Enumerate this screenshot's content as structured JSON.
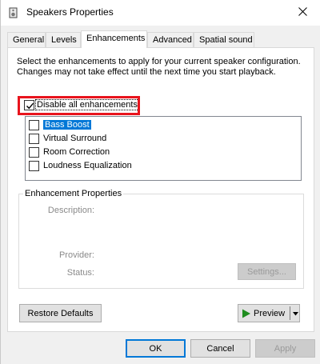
{
  "window": {
    "title": "Speakers Properties"
  },
  "tabs": [
    {
      "label": "General",
      "active": false
    },
    {
      "label": "Levels",
      "active": false
    },
    {
      "label": "Enhancements",
      "active": true
    },
    {
      "label": "Advanced",
      "active": false
    },
    {
      "label": "Spatial sound",
      "active": false
    }
  ],
  "enhancements": {
    "description": "Select the enhancements to apply for your current speaker configuration. Changes may not take effect until the next time you start playback.",
    "disable_all": {
      "label": "Disable all enhancements",
      "checked": true
    },
    "items": [
      {
        "label": "Bass Boost",
        "checked": false,
        "selected": true
      },
      {
        "label": "Virtual Surround",
        "checked": false,
        "selected": false
      },
      {
        "label": "Room Correction",
        "checked": false,
        "selected": false
      },
      {
        "label": "Loudness Equalization",
        "checked": false,
        "selected": false
      }
    ]
  },
  "properties": {
    "group_title": "Enhancement Properties",
    "description_label": "Description:",
    "provider_label": "Provider:",
    "status_label": "Status:",
    "settings_button": "Settings..."
  },
  "actions": {
    "restore_defaults": "Restore Defaults",
    "preview": "Preview"
  },
  "footer": {
    "ok": "OK",
    "cancel": "Cancel",
    "apply": "Apply"
  },
  "colors": {
    "highlight_border": "#e8141d",
    "selection": "#0078d7",
    "preview_play": "#1e8c1e"
  },
  "icons": {
    "title": "speaker-icon",
    "close": "close-icon",
    "checkmark": "checkmark-icon",
    "preview_play": "play-icon",
    "dropdown": "chevron-down-icon"
  }
}
